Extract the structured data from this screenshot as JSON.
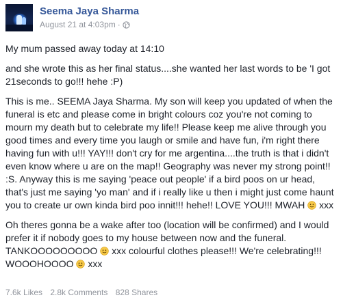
{
  "author": {
    "name": "Seema Jaya Sharma",
    "timestamp": "August 21 at 4:03pm",
    "separator": "·",
    "privacy_icon": "globe-icon",
    "avatar": "avatar-photo"
  },
  "post": {
    "paragraph_1": "My mum passed away today at 14:10",
    "paragraph_2": "and she wrote this as her final status....she wanted her last words to be 'I got 21seconds to go!!! hehe :P)",
    "paragraph_3_part1": "This is me.. SEEMA Jaya Sharma. My son will keep you updated of when the funeral is etc and please come in bright colours coz you're not coming to mourn my death but to celebrate my life!! Please keep me alive through you good times and every time you laugh or smile and have fun, i'm right there having fun with u!!! YAY!!! don't cry for me argentina....the truth is that i didn't even know where u are on the map!! Geography was never my strong point!! :S. Anyway this is me saying 'peace out people' if a bird poos on ur head, that's just me saying 'yo man' and if i really like u then i might just come haunt you to create ur own kinda bird poo innit!!! hehe!! LOVE YOU!!! MWAH ",
    "paragraph_3_part2": " xxx",
    "paragraph_4_part1": "Oh theres gonna be a wake after too (location will be confirmed) and I would prefer it if nobody goes to my house between now and the funeral. TANKOOOOOOOOO ",
    "paragraph_4_part2": " xxx colourful clothes please!!! We're celebrating!!! WOOOHOOOO ",
    "paragraph_4_part3": " xxx",
    "emoji_icon": "smiley-emoji-icon"
  },
  "stats": {
    "likes": "7.6k Likes",
    "comments": "2.8k Comments",
    "shares": "828 Shares"
  },
  "colors": {
    "name": "#365899",
    "meta": "#90949c",
    "text": "#1d2129",
    "emoji": "#f7c948"
  }
}
